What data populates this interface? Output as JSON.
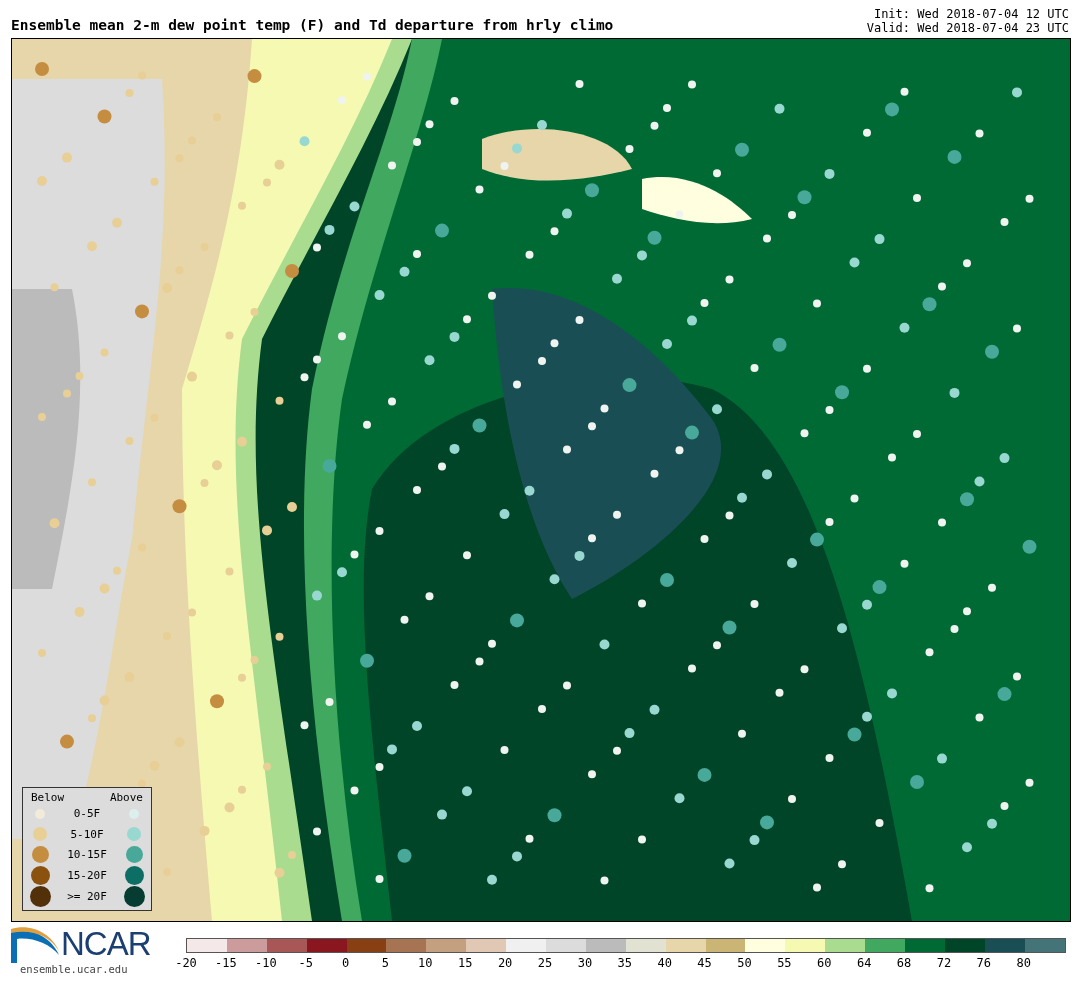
{
  "title": "Ensemble mean 2-m dew point temp (F) and Td departure from hrly climo",
  "init": "Init: Wed 2018-07-04 12 UTC",
  "valid": "Valid: Wed 2018-07-04 23 UTC",
  "legend": {
    "below_heading": "Below",
    "above_heading": "Above",
    "items": [
      {
        "label": "0-5F",
        "below": {
          "color": "#f3ebd9"
        },
        "above": {
          "color": "#dcefed"
        }
      },
      {
        "label": "5-10F",
        "below": {
          "color": "#e8cf95"
        },
        "above": {
          "color": "#98d8d0"
        }
      },
      {
        "label": "10-15F",
        "below": {
          "color": "#c58d40"
        },
        "above": {
          "color": "#48a89a"
        }
      },
      {
        "label": "15-20F",
        "below": {
          "color": "#8b520f"
        },
        "above": {
          "color": "#0c6e64"
        }
      },
      {
        "label": ">= 20F",
        "below": {
          "color": "#52300a"
        },
        "above": {
          "color": "#063c32"
        }
      }
    ]
  },
  "logo": {
    "name": "NCAR",
    "url": "ensemble.ucar.edu"
  },
  "colorbar": {
    "segments": [
      {
        "label": "-20",
        "color": "#f4e8e8"
      },
      {
        "label": "-15",
        "color": "#cc9b9b"
      },
      {
        "label": "-10",
        "color": "#a85656"
      },
      {
        "label": "-5",
        "color": "#8a1620"
      },
      {
        "label": "0",
        "color": "#884012"
      },
      {
        "label": "5",
        "color": "#a67452"
      },
      {
        "label": "10",
        "color": "#c4a080"
      },
      {
        "label": "15",
        "color": "#e0c8b5"
      },
      {
        "label": "20",
        "color": "#f0f0f0"
      },
      {
        "label": "25",
        "color": "#dcdcdc"
      },
      {
        "label": "30",
        "color": "#bbbbbb"
      },
      {
        "label": "35",
        "color": "#e2e2d2"
      },
      {
        "label": "40",
        "color": "#e6d6a9"
      },
      {
        "label": "45",
        "color": "#cbb575"
      },
      {
        "label": "50",
        "color": "#ffffe0"
      },
      {
        "label": "55",
        "color": "#f5f9b2"
      },
      {
        "label": "60",
        "color": "#a9dc8f"
      },
      {
        "label": "64",
        "color": "#41a85f"
      },
      {
        "label": "68",
        "color": "#006a35"
      },
      {
        "label": "72",
        "color": "#004528"
      },
      {
        "label": "76",
        "color": "#1a4e55"
      },
      {
        "label": "80",
        "color": "#457478"
      }
    ]
  }
}
